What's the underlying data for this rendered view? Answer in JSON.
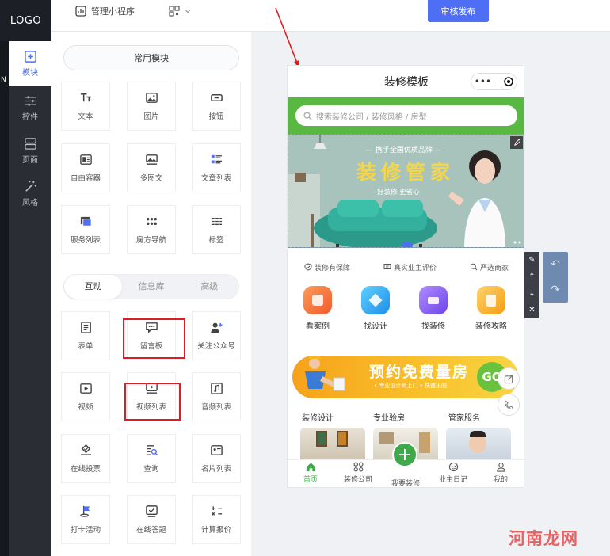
{
  "header": {
    "logo": "LOGO",
    "manage_label": "管理小程序",
    "publish_label": "审核发布"
  },
  "nav": {
    "mark": "N",
    "items": [
      {
        "label": "模块",
        "icon": "plus-square-icon",
        "active": true
      },
      {
        "label": "控件",
        "icon": "sliders-icon",
        "active": false
      },
      {
        "label": "页面",
        "icon": "pages-icon",
        "active": false
      },
      {
        "label": "风格",
        "icon": "magic-wand-icon",
        "active": false
      }
    ]
  },
  "panel": {
    "common_title": "常用模块",
    "common_tiles": [
      {
        "label": "文本",
        "icon": "text-icon"
      },
      {
        "label": "图片",
        "icon": "image-icon"
      },
      {
        "label": "按钮",
        "icon": "button-icon"
      },
      {
        "label": "自由容器",
        "icon": "container-icon"
      },
      {
        "label": "多图文",
        "icon": "multi-image-text-icon"
      },
      {
        "label": "文章列表",
        "icon": "article-list-icon"
      },
      {
        "label": "服务列表",
        "icon": "service-list-icon"
      },
      {
        "label": "魔方导航",
        "icon": "grid-nav-icon"
      },
      {
        "label": "标签",
        "icon": "tag-icon"
      }
    ],
    "tabs": [
      {
        "label": "互动",
        "active": true
      },
      {
        "label": "信息库",
        "active": false
      },
      {
        "label": "高级",
        "active": false
      }
    ],
    "interact_tiles": [
      {
        "label": "表单",
        "icon": "form-icon"
      },
      {
        "label": "留言板",
        "icon": "message-board-icon",
        "highlighted": true
      },
      {
        "label": "关注公众号",
        "icon": "follow-user-icon"
      },
      {
        "label": "视频",
        "icon": "video-icon"
      },
      {
        "label": "视频列表",
        "icon": "video-list-icon",
        "highlighted": true
      },
      {
        "label": "音频列表",
        "icon": "audio-list-icon"
      },
      {
        "label": "在线投票",
        "icon": "vote-icon"
      },
      {
        "label": "查询",
        "icon": "query-icon"
      },
      {
        "label": "名片列表",
        "icon": "card-list-icon"
      },
      {
        "label": "打卡活动",
        "icon": "checkin-flag-icon"
      },
      {
        "label": "在线答题",
        "icon": "quiz-icon"
      },
      {
        "label": "计算报价",
        "icon": "calculator-icon"
      }
    ]
  },
  "phone": {
    "title": "装修模板",
    "search_placeholder": "搜索装修公司 / 装修风格 / 房型",
    "banner": {
      "subtitle": "— 携手全国优质品牌 —",
      "title": "装修管家",
      "slogan": "好装修  更省心"
    },
    "guarantees": [
      "装修有保障",
      "真实业主评价",
      "严选商家"
    ],
    "quick_icons": [
      {
        "label": "看案例",
        "color": "#f46a3b"
      },
      {
        "label": "找设计",
        "color": "#2ea8f0"
      },
      {
        "label": "找装修",
        "color": "#8a63f0"
      },
      {
        "label": "装修攻略",
        "color": "#f6a623"
      }
    ],
    "promo": {
      "title": "预约免费量房",
      "subtitle": "• 专业设计师上门 • 快速出图",
      "button": "GO"
    },
    "sections": [
      "装修设计",
      "专业验房",
      "管家服务"
    ],
    "tabbar": [
      {
        "label": "首页",
        "icon": "home-icon",
        "active": true
      },
      {
        "label": "装修公司",
        "icon": "company-icon",
        "active": false
      },
      {
        "label": "我要装修",
        "icon": "plus-icon",
        "active": false
      },
      {
        "label": "业主日记",
        "icon": "diary-icon",
        "active": false
      },
      {
        "label": "我的",
        "icon": "user-icon",
        "active": false
      }
    ]
  },
  "watermark": "河南龙网",
  "colors": {
    "accent": "#4f6ef6",
    "highlight": "#e01b22",
    "phone_green": "#58b842"
  }
}
